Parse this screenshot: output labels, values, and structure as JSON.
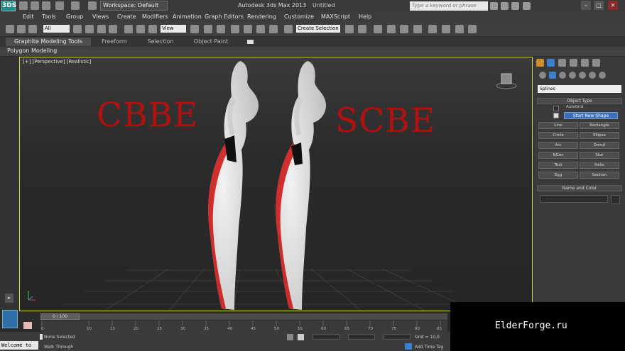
{
  "title_bar": {
    "logo": "3DS",
    "workspace": "Workspace: Default",
    "app_title": "Autodesk 3ds Max  2013",
    "doc_title": "Untitled",
    "search_placeholder": "Type a keyword or phrase"
  },
  "menu": [
    "Edit",
    "Tools",
    "Group",
    "Views",
    "Create",
    "Modifiers",
    "Animation",
    "Graph Editors",
    "Rendering",
    "Customize",
    "MAXScript",
    "Help"
  ],
  "toolbar": {
    "selection_filter": "All",
    "reference_coord": "View",
    "named_selection": "Create Selection"
  },
  "ribbon": {
    "tabs": [
      "Graphite Modeling Tools",
      "Freeform",
      "Selection",
      "Object Paint"
    ],
    "active_tab": "Graphite Modeling Tools",
    "panel_label": "Polygon Modeling"
  },
  "viewport": {
    "label": "[+] [Perspective] [Realistic]",
    "left_text": "CBBE",
    "right_text": "SCBE",
    "text_color": "#b3110f"
  },
  "command_panel": {
    "category": "Splines",
    "object_type_header": "Object Type",
    "autogrid": "AutoGrid",
    "start_new_shape": "Start New Shape",
    "buttons": [
      "Line",
      "Rectangle",
      "Circle",
      "Ellipse",
      "Arc",
      "Donut",
      "NGon",
      "Star",
      "Text",
      "Helix",
      "Egg",
      "Section"
    ],
    "name_color_header": "Name and Color"
  },
  "timeline": {
    "frame_indicator": "0 / 100",
    "ticks": [
      "0",
      "10",
      "15",
      "20",
      "25",
      "30",
      "35",
      "40",
      "45",
      "50",
      "55",
      "60",
      "65",
      "70",
      "75",
      "80",
      "85"
    ]
  },
  "status": {
    "selection": "None Selected",
    "prompt": "Walk Through",
    "grid": "Grid = 10,0",
    "add_time_tag": "Add Time Tag",
    "maxscript_listener": "Welcome to"
  },
  "watermark": "ElderForge.ru"
}
